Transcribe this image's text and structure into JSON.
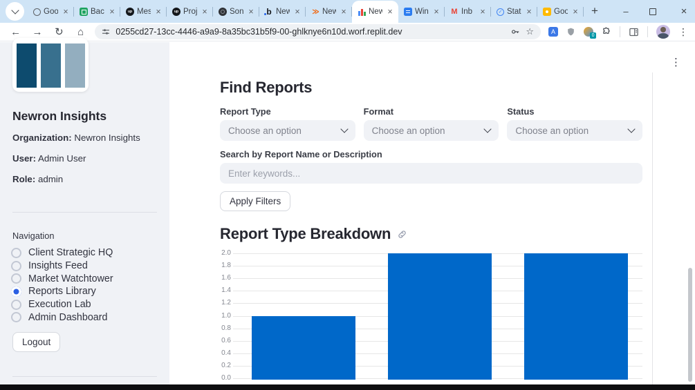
{
  "browser": {
    "tabs": [
      {
        "title": "Goo",
        "icon": "globe"
      },
      {
        "title": "Back",
        "icon": "sheets"
      },
      {
        "title": "Mes",
        "icon": "upwork"
      },
      {
        "title": "Proj",
        "icon": "upwork"
      },
      {
        "title": "Son",
        "icon": "sonar"
      },
      {
        "title": "New",
        "icon": "bolt"
      },
      {
        "title": "New",
        "icon": "replit"
      },
      {
        "title": "New",
        "icon": "chart",
        "active": true
      },
      {
        "title": "Win",
        "icon": "doc"
      },
      {
        "title": "Inb",
        "icon": "gmail"
      },
      {
        "title": "Stat",
        "icon": "check"
      },
      {
        "title": "Goo",
        "icon": "keep"
      }
    ],
    "new_tab_label": "+",
    "toolbar": {
      "url": "0255cd27-13cc-4446-a9a9-8a35bc31b5f9-00-ghlknye6n10d.worf.replit.dev",
      "extension_badge": "0"
    }
  },
  "sidebar": {
    "app_title": "Newron Insights",
    "org_label": "Organization:",
    "org_value": " Newron Insights",
    "user_label": "User:",
    "user_value": " Admin User",
    "role_label": "Role:",
    "role_value": " admin",
    "nav_label": "Navigation",
    "nav_items": [
      {
        "label": "Client Strategic HQ",
        "selected": false
      },
      {
        "label": "Insights Feed",
        "selected": false
      },
      {
        "label": "Market Watchtower",
        "selected": false
      },
      {
        "label": "Reports Library",
        "selected": true
      },
      {
        "label": "Execution Lab",
        "selected": false
      },
      {
        "label": "Admin Dashboard",
        "selected": false
      }
    ],
    "logout_label": "Logout",
    "logo_bar_colors": [
      "#0d4b6e",
      "#38708e",
      "#93aebf"
    ]
  },
  "main": {
    "find_reports_title": "Find Reports",
    "filters": [
      {
        "label": "Report Type",
        "placeholder": "Choose an option"
      },
      {
        "label": "Format",
        "placeholder": "Choose an option"
      },
      {
        "label": "Status",
        "placeholder": "Choose an option"
      }
    ],
    "search_label": "Search by Report Name or Description",
    "search_placeholder": "Enter keywords...",
    "apply_button_label": "Apply Filters",
    "chart_section_title": "Report Type Breakdown"
  },
  "chart_data": {
    "type": "bar",
    "title": "Report Type Breakdown",
    "values": [
      1.0,
      2.0,
      2.0
    ],
    "ylim": [
      0.0,
      2.0
    ],
    "ytick_labels": [
      "0.0",
      "0.2",
      "0.4",
      "0.6",
      "0.8",
      "1.0",
      "1.2",
      "1.4",
      "1.6",
      "1.8",
      "2.0"
    ],
    "bar_color": "#0068c9",
    "grid": true,
    "legend": "none",
    "x_axis_labels_visible": false
  },
  "colors": {
    "accent_radio": "#2b5fe3",
    "sidebar_bg": "#f0f2f6",
    "widget_bg": "#f0f2f6",
    "chart_bar": "#0068c9",
    "tabstrip_bg": "#cfe4f6"
  }
}
